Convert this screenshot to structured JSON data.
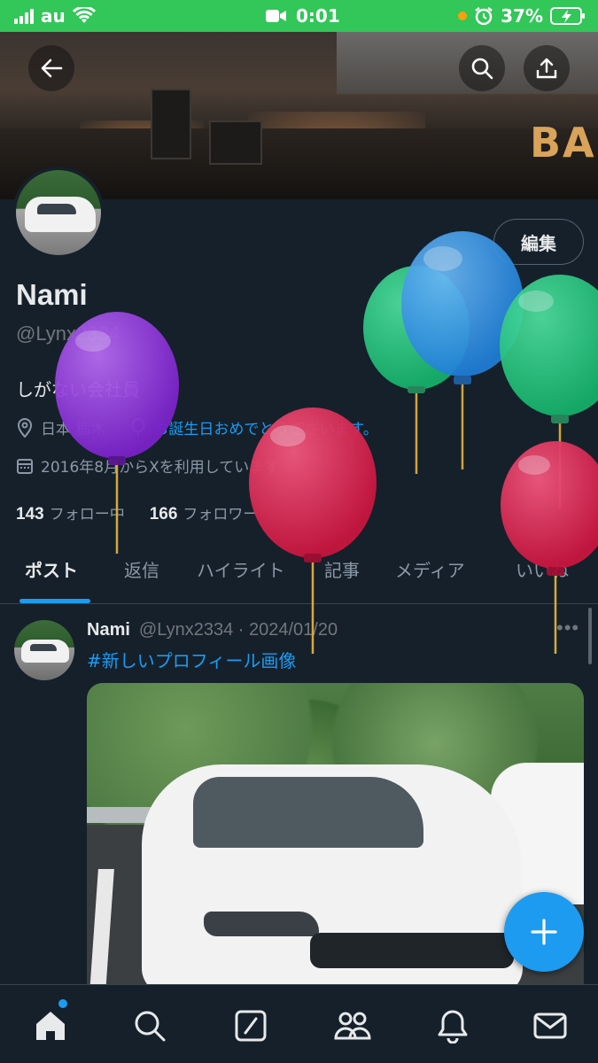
{
  "status_bar": {
    "carrier": "au",
    "time": "0:01",
    "battery": "37%"
  },
  "banner": {
    "sign_text": "BA"
  },
  "header": {
    "back_icon": "arrow-left-icon",
    "search_icon": "search-icon",
    "share_icon": "share-icon"
  },
  "profile": {
    "edit_label": "編集",
    "display_name": "Nami",
    "handle": "@Lynx2334",
    "bio": "しがない会社員",
    "location": "日本 栃木",
    "birthday": "お誕生日おめでとうございます。",
    "joined": "2016年8月からXを利用しています",
    "following_count": "143",
    "following_label": "フォロー中",
    "followers_count": "166",
    "followers_label": "フォロワー"
  },
  "tabs": [
    "ポスト",
    "返信",
    "ハイライト",
    "記事",
    "メディア",
    "いいね"
  ],
  "post": {
    "name": "Nami",
    "handle_date": "@Lynx2334 · 2024/01/20",
    "more": "•••",
    "text": "#新しいプロフィール画像"
  },
  "fab_icon": "plus-icon",
  "bottom_nav": [
    "home-icon",
    "search-icon",
    "compose-icon",
    "communities-icon",
    "notifications-icon",
    "messages-icon"
  ],
  "colors": {
    "background": "#15202b",
    "accent": "#1d9bf0",
    "status_bar": "#33c659"
  }
}
